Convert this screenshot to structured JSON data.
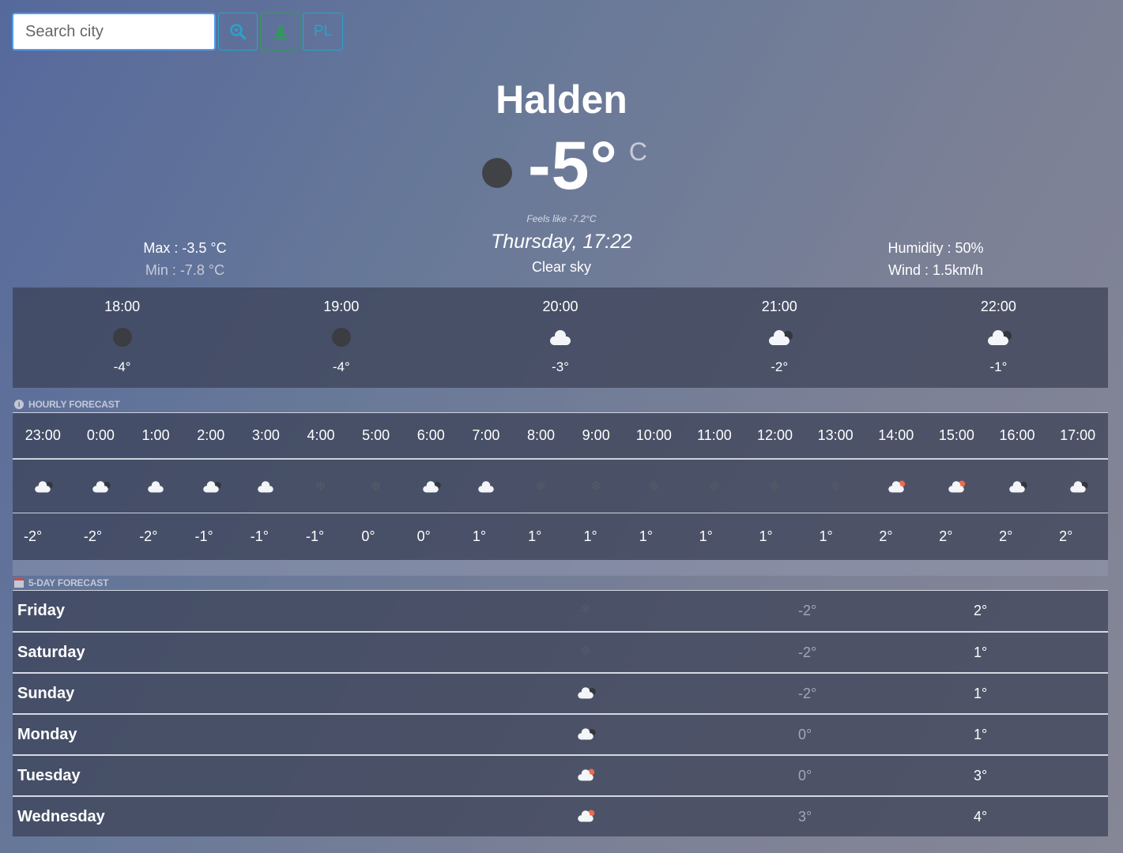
{
  "search": {
    "placeholder": "Search city"
  },
  "toolbar": {
    "search_icon": "magnifier-icon",
    "locate_icon": "tree-location-icon",
    "lang_label": "PL"
  },
  "current": {
    "city": "Halden",
    "temp": "-5°",
    "unit": "C",
    "icon": "moon-icon",
    "feels_like": "Feels like -7.2°C",
    "datetime": "Thursday, 17:22",
    "description": "Clear sky",
    "max": "Max : -3.5 °C",
    "min": "Min : -7.8 °C",
    "humidity": "Humidity : 50%",
    "wind": "Wind : 1.5km/h"
  },
  "next_hours": [
    {
      "time": "18:00",
      "icon": "moon-icon",
      "temp": "-4°"
    },
    {
      "time": "19:00",
      "icon": "moon-icon",
      "temp": "-4°"
    },
    {
      "time": "20:00",
      "icon": "cloud-icon",
      "temp": "-3°"
    },
    {
      "time": "21:00",
      "icon": "cloud-moon-icon",
      "temp": "-2°"
    },
    {
      "time": "22:00",
      "icon": "cloud-moon-icon",
      "temp": "-1°"
    }
  ],
  "hourly_title": "HOURLY FORECAST",
  "hourly": [
    {
      "time": "23:00",
      "icon": "cloud-moon-icon",
      "temp": "-2°"
    },
    {
      "time": "0:00",
      "icon": "cloud-moon-icon",
      "temp": "-2°"
    },
    {
      "time": "1:00",
      "icon": "cloud-icon",
      "temp": "-2°"
    },
    {
      "time": "2:00",
      "icon": "cloud-moon-icon",
      "temp": "-1°"
    },
    {
      "time": "3:00",
      "icon": "cloud-icon",
      "temp": "-1°"
    },
    {
      "time": "4:00",
      "icon": "snow-icon",
      "temp": "-1°"
    },
    {
      "time": "5:00",
      "icon": "snow-icon",
      "temp": "0°"
    },
    {
      "time": "6:00",
      "icon": "cloud-moon-icon",
      "temp": "0°"
    },
    {
      "time": "7:00",
      "icon": "cloud-icon",
      "temp": "1°"
    },
    {
      "time": "8:00",
      "icon": "snow-icon",
      "temp": "1°"
    },
    {
      "time": "9:00",
      "icon": "snow-icon",
      "temp": "1°"
    },
    {
      "time": "10:00",
      "icon": "snow-icon",
      "temp": "1°"
    },
    {
      "time": "11:00",
      "icon": "snow-icon",
      "temp": "1°"
    },
    {
      "time": "12:00",
      "icon": "snow-icon",
      "temp": "1°"
    },
    {
      "time": "13:00",
      "icon": "snow-icon",
      "temp": "1°"
    },
    {
      "time": "14:00",
      "icon": "cloud-sun-icon",
      "temp": "2°"
    },
    {
      "time": "15:00",
      "icon": "cloud-sun-icon",
      "temp": "2°"
    },
    {
      "time": "16:00",
      "icon": "cloud-moon-icon",
      "temp": "2°"
    },
    {
      "time": "17:00",
      "icon": "cloud-moon-icon",
      "temp": "2°"
    }
  ],
  "daily_title": "5-DAY FORECAST",
  "daily": [
    {
      "day": "Friday",
      "icon": "snow-icon",
      "min": "-2°",
      "max": "2°"
    },
    {
      "day": "Saturday",
      "icon": "snow-icon",
      "min": "-2°",
      "max": "1°"
    },
    {
      "day": "Sunday",
      "icon": "cloud-moon-icon",
      "min": "-2°",
      "max": "1°"
    },
    {
      "day": "Monday",
      "icon": "cloud-moon-icon",
      "min": "0°",
      "max": "1°"
    },
    {
      "day": "Tuesday",
      "icon": "cloud-sun-icon",
      "min": "0°",
      "max": "3°"
    },
    {
      "day": "Wednesday",
      "icon": "cloud-sun-icon",
      "min": "3°",
      "max": "4°"
    }
  ],
  "colors": {
    "accent_blue": "#2aa2c8",
    "accent_green": "#2e9c57",
    "sun": "#ef6a4c"
  }
}
